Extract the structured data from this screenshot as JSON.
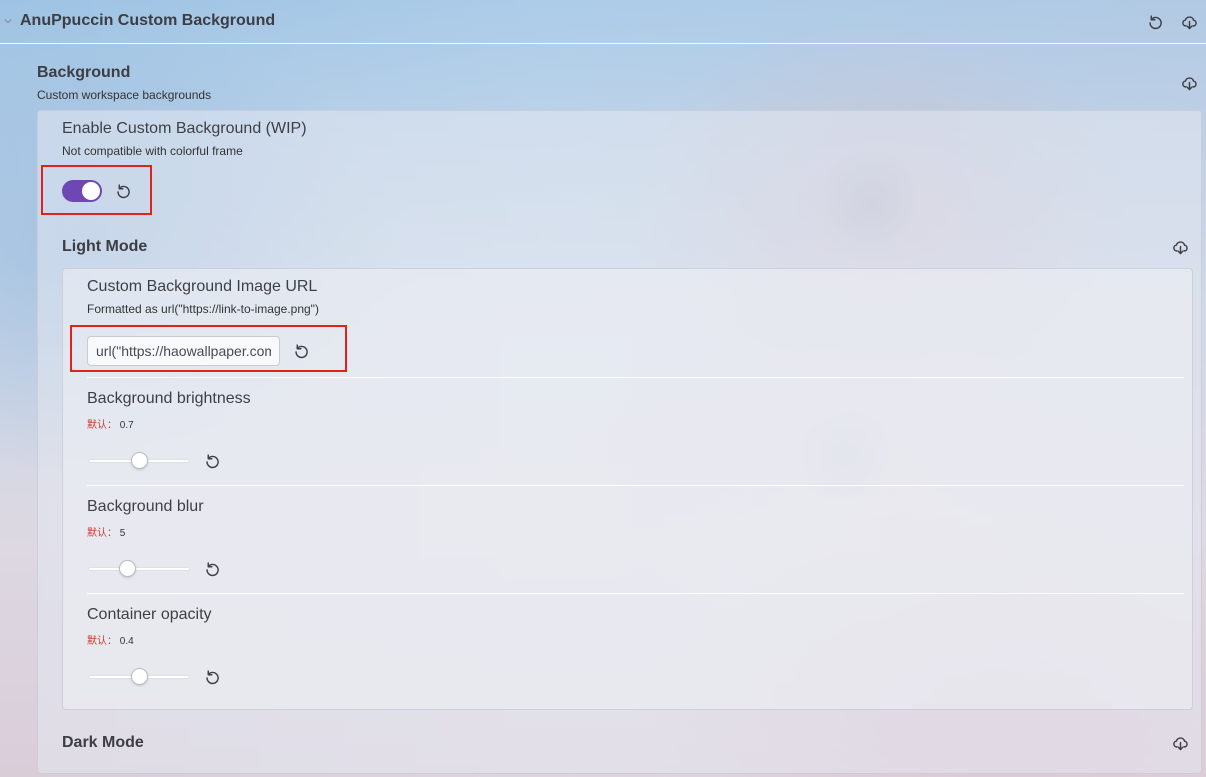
{
  "header": {
    "title": "AnuPpuccin Custom Background"
  },
  "background": {
    "title": "Background",
    "description": "Custom workspace backgrounds",
    "enable": {
      "name": "Enable Custom Background (WIP)",
      "description": "Not compatible with colorful frame",
      "enabled": true
    },
    "light_mode": {
      "title": "Light Mode",
      "image_url": {
        "name": "Custom Background Image URL",
        "description": "Formatted as url(\"https://link-to-image.png\")",
        "value": "url(\"https://haowallpaper.com"
      },
      "brightness": {
        "name": "Background brightness",
        "default_label": "默认：",
        "default_value": "0.7",
        "value": 0.7,
        "min": 0,
        "max": 1.4
      },
      "blur": {
        "name": "Background blur",
        "default_label": "默认：",
        "default_value": "5",
        "value": 5,
        "min": 0,
        "max": 13
      },
      "opacity": {
        "name": "Container opacity",
        "default_label": "默认：",
        "default_value": "0.4",
        "value": 0.4,
        "min": 0,
        "max": 0.8
      }
    },
    "dark_mode": {
      "title": "Dark Mode"
    }
  },
  "icons": {
    "reset": "reset-icon",
    "export": "cloud-download-icon",
    "collapse": "chevron-down-icon"
  },
  "colors": {
    "toggle_on": "#6f47b5",
    "highlight": "#e0221b",
    "default_label": "#d23a2a"
  }
}
